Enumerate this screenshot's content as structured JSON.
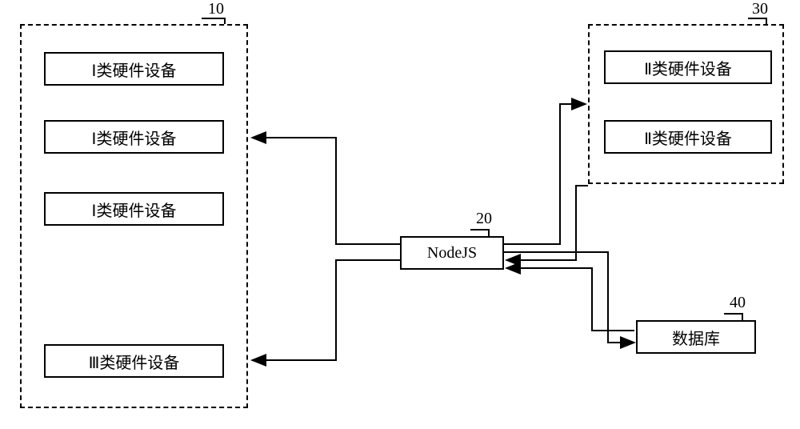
{
  "groups": {
    "group10": {
      "label": "10",
      "items": [
        "Ⅰ类硬件设备",
        "Ⅰ类硬件设备",
        "Ⅰ类硬件设备",
        "Ⅲ类硬件设备"
      ]
    },
    "group30": {
      "label": "30",
      "items": [
        "Ⅱ类硬件设备",
        "Ⅱ类硬件设备"
      ]
    },
    "node20": {
      "label": "20",
      "text": "NodeJS"
    },
    "node40": {
      "label": "40",
      "text": "数据库"
    }
  }
}
